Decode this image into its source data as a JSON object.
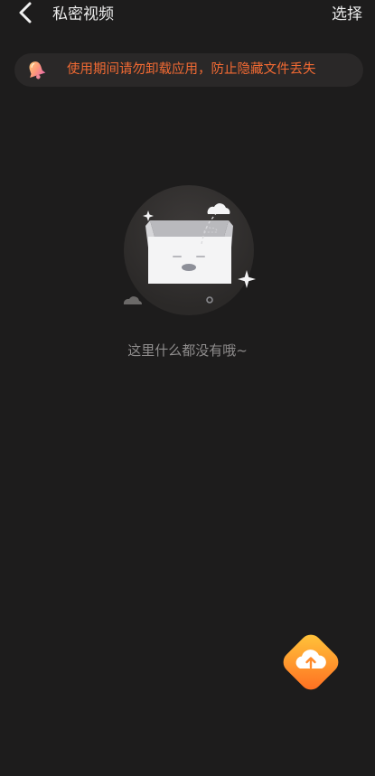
{
  "header": {
    "title": "私密视频",
    "select_label": "选择"
  },
  "notice": {
    "icon": "bell-icon",
    "text": "使用期间请勿卸载应用，防止隐藏文件丢失",
    "text_color": "#f26a33"
  },
  "empty_state": {
    "illustration": "empty-box-illustration",
    "message": "这里什么都没有哦~"
  },
  "upload_button": {
    "icon": "cloud-upload-icon",
    "gradient_start": "#ffc93c",
    "gradient_end": "#ff6a20"
  },
  "colors": {
    "background": "#1d1c1c",
    "notice_background": "#2a2828"
  }
}
